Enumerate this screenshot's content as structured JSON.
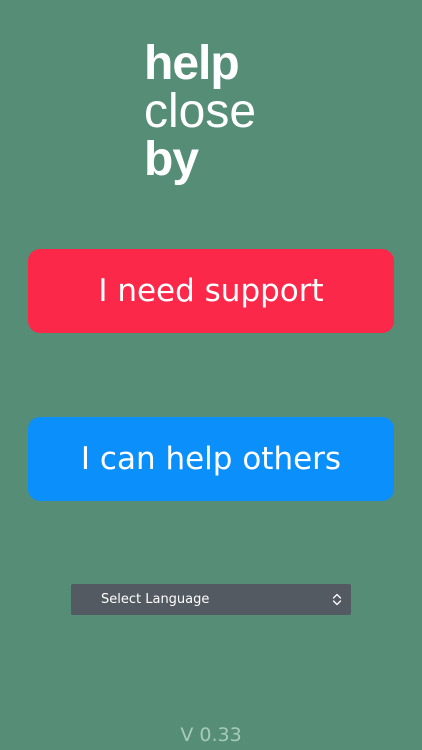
{
  "logo": {
    "line1": "help",
    "line2": "close",
    "line3": "by"
  },
  "buttons": {
    "need_support": "I need support",
    "help_others": "I can help others"
  },
  "language_select": {
    "selected": "Select Language",
    "icon": "chevron-up-down-icon"
  },
  "footer": {
    "version": "V 0.33"
  },
  "colors": {
    "background": "#558d76",
    "support_button": "#fb284a",
    "help_button": "#0b8ffb",
    "select_bg": "#545a62",
    "version_text": "#a6cbb9"
  }
}
